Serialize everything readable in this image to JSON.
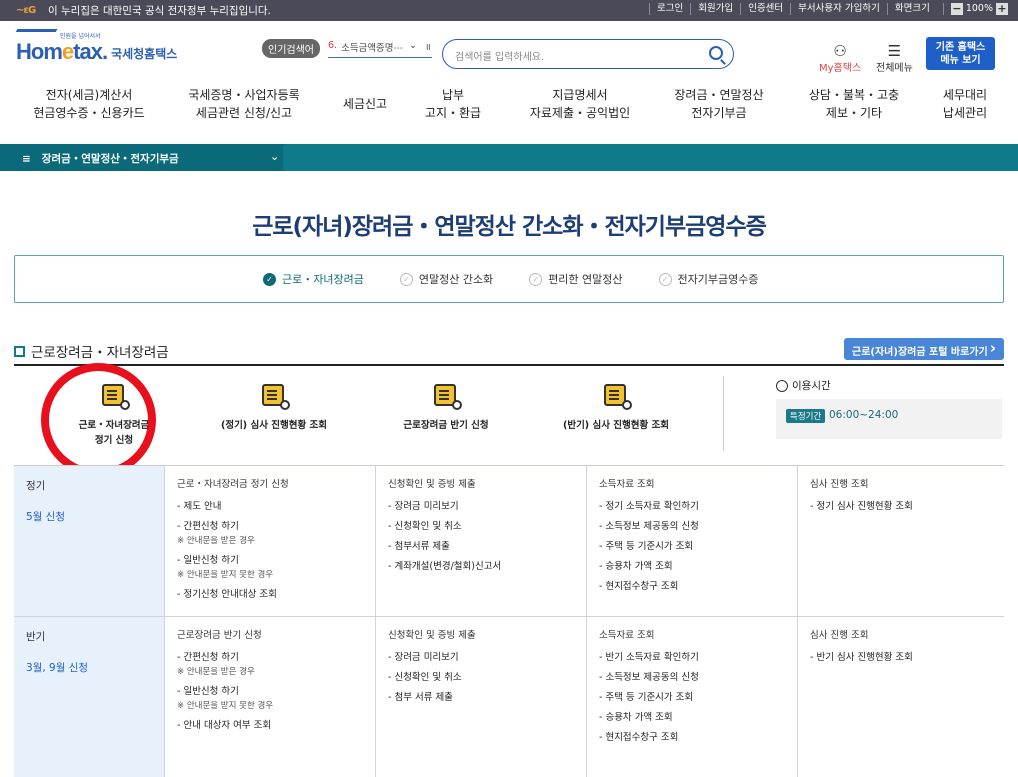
{
  "topbar": {
    "gov_notice": "이 누리집은 대한민국 공식 전자정부 누리집입니다.",
    "links": [
      "로그인",
      "회원가입",
      "인증센터",
      "부서사용자 가입하기",
      "화면크기"
    ],
    "zoom": "100%"
  },
  "header": {
    "logo_text": "Hometax",
    "logo_kor": "국세청홈택스",
    "logo_tiny": "민원을 넘어서서",
    "popular_badge": "인기검색어",
    "popular_num": "6.",
    "popular_item": "소득금액증명⋯",
    "search_placeholder": "검색어를 입력하세요.",
    "my_hometax": "My홈택스",
    "all_menu": "전체메뉴",
    "old_menu_1": "기존 홈택스",
    "old_menu_2": "메뉴 보기"
  },
  "gnb": [
    {
      "l1": "전자(세금)계산서",
      "l2": "현금영수증・신용카드"
    },
    {
      "l1": "국세증명・사업자등록",
      "l2": "세금관련 신청/신고"
    },
    {
      "l1": "세금신고",
      "l2": ""
    },
    {
      "l1": "납부",
      "l2": "고지・환급"
    },
    {
      "l1": "지급명세서",
      "l2": "자료제출・공익법인"
    },
    {
      "l1": "장려금・연말정산",
      "l2": "전자기부금"
    },
    {
      "l1": "상담・불복・고충",
      "l2": "제보・기타"
    },
    {
      "l1": "세무대리",
      "l2": "납세관리"
    }
  ],
  "breadcrumb": {
    "label": "장려금・연말정산・전자기부금"
  },
  "page_title": "근로(자녀)장려금・연말정산 간소화・전자기부금영수증",
  "tabs": [
    {
      "label": "근로・자녀장려금",
      "active": true
    },
    {
      "label": "연말정산 간소화",
      "active": false
    },
    {
      "label": "편리한 연말정산",
      "active": false
    },
    {
      "label": "전자기부금영수증",
      "active": false
    }
  ],
  "section": {
    "title": "근로장려금・자녀장려금",
    "portal_button": "근로(자녀)장려금 포털 바로가기"
  },
  "quick_items": [
    {
      "l1": "근로・자녀장려금",
      "l2": "정기 신청"
    },
    {
      "l1": "(정기) 심사 진행현황 조회",
      "l2": ""
    },
    {
      "l1": "근로장려금 반기 신청",
      "l2": ""
    },
    {
      "l1": "(반기) 심사 진행현황 조회",
      "l2": ""
    }
  ],
  "use_time": {
    "label": "이용시간",
    "badge": "특정기간",
    "time": "06:00~24:00"
  },
  "rows": [
    {
      "title": "정기",
      "sub": "5월 신청",
      "cols": [
        {
          "head": "근로・자녀장려금 정기 신청",
          "items": [
            {
              "t": "- 제도 안내",
              "n": ""
            },
            {
              "t": "- 간편신청 하기",
              "n": "※ 안내문을 받은 경우"
            },
            {
              "t": "- 일반신청 하기",
              "n": "※ 안내문을 받지 못한 경우"
            },
            {
              "t": "- 정기신청 안내대상 조회",
              "n": ""
            }
          ]
        },
        {
          "head": "신청확인 및 증빙 제출",
          "items": [
            {
              "t": "- 장려금 미리보기",
              "n": ""
            },
            {
              "t": "- 신청확인 및 취소",
              "n": ""
            },
            {
              "t": "- 첨부서류 제출",
              "n": ""
            },
            {
              "t": "- 계좌개설(변경/철회)신고서",
              "n": ""
            }
          ]
        },
        {
          "head": "소득자료 조회",
          "items": [
            {
              "t": "- 정기 소득자료 확인하기",
              "n": ""
            },
            {
              "t": "- 소득정보 제공동의 신청",
              "n": ""
            },
            {
              "t": "- 주택 등 기준시가 조회",
              "n": ""
            },
            {
              "t": "- 승용차 가액 조회",
              "n": ""
            },
            {
              "t": "- 현지접수창구 조회",
              "n": ""
            }
          ]
        },
        {
          "head": "심사 진행 조회",
          "items": [
            {
              "t": "- 정기 심사 진행현황 조회",
              "n": ""
            }
          ]
        }
      ]
    },
    {
      "title": "반기",
      "sub": "3월, 9월 신청",
      "cols": [
        {
          "head": "근로장려금 반기 신청",
          "items": [
            {
              "t": "- 간편신청 하기",
              "n": "※ 안내문을 받은 경우"
            },
            {
              "t": "- 일반신청 하기",
              "n": "※ 안내문을 받지 못한 경우"
            },
            {
              "t": "- 안내 대상자 여부 조회",
              "n": ""
            }
          ]
        },
        {
          "head": "신청확인 및 증빙 제출",
          "items": [
            {
              "t": "- 장려금 미리보기",
              "n": ""
            },
            {
              "t": "- 신청확인 및 취소",
              "n": ""
            },
            {
              "t": "- 첨부 서류 제출",
              "n": ""
            }
          ]
        },
        {
          "head": "소득자료 조회",
          "items": [
            {
              "t": "- 반기 소득자료 확인하기",
              "n": ""
            },
            {
              "t": "- 소득정보 제공동의 신청",
              "n": ""
            },
            {
              "t": "- 주택 등 기준시가 조회",
              "n": ""
            },
            {
              "t": "- 승용차 가액 조회",
              "n": ""
            },
            {
              "t": "- 현지접수창구 조회",
              "n": ""
            }
          ]
        },
        {
          "head": "심사 진행 조회",
          "items": [
            {
              "t": "- 반기 심사 진행현황 조회",
              "n": ""
            }
          ]
        }
      ]
    }
  ],
  "colors": {
    "teal": "#0e7a8a",
    "blue": "#1f5fc8",
    "navy": "#1d3d75",
    "red": "#e8101c"
  }
}
